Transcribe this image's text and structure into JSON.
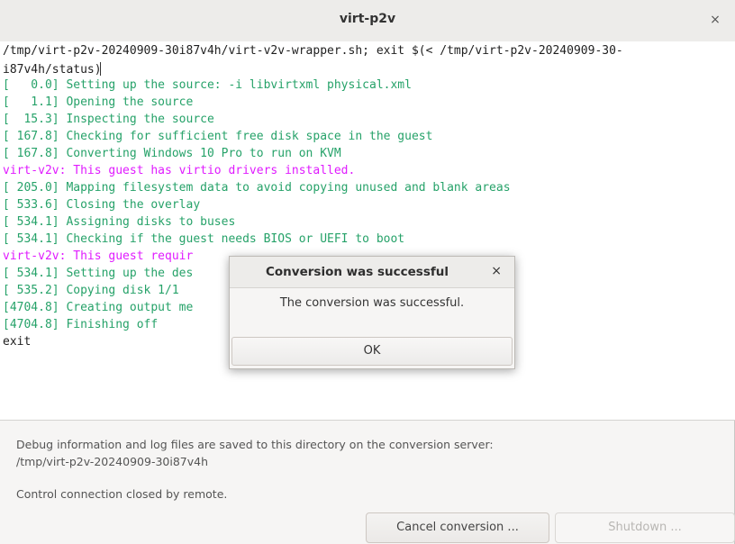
{
  "window": {
    "title": "virt-p2v",
    "close_glyph": "×"
  },
  "terminal": {
    "lines": [
      {
        "text": "/tmp/virt-p2v-20240909-30i87v4h/virt-v2v-wrapper.sh; exit $(< /tmp/virt-p2v-20240909-30-",
        "color": "black"
      },
      {
        "text": "i87v4h/status)",
        "color": "black"
      },
      {
        "text": "[   0.0] Setting up the source: -i libvirtxml physical.xml",
        "color": "green"
      },
      {
        "text": "[   1.1] Opening the source",
        "color": "green"
      },
      {
        "text": "[  15.3] Inspecting the source",
        "color": "green"
      },
      {
        "text": "[ 167.8] Checking for sufficient free disk space in the guest",
        "color": "green"
      },
      {
        "text": "[ 167.8] Converting Windows 10 Pro to run on KVM",
        "color": "green"
      },
      {
        "text": "virt-v2v: This guest has virtio drivers installed.",
        "color": "magenta"
      },
      {
        "text": "[ 205.0] Mapping filesystem data to avoid copying unused and blank areas",
        "color": "green"
      },
      {
        "text": "[ 533.6] Closing the overlay",
        "color": "green"
      },
      {
        "text": "[ 534.1] Assigning disks to buses",
        "color": "green"
      },
      {
        "text": "[ 534.1] Checking if the guest needs BIOS or UEFI to boot",
        "color": "green"
      },
      {
        "text": "virt-v2v: This guest requir",
        "color": "magenta"
      },
      {
        "text": "[ 534.1] Setting up the des",
        "color": "green"
      },
      {
        "text": "[ 535.2] Copying disk 1/1",
        "color": "green"
      },
      {
        "text": "[4704.8] Creating output me",
        "color": "green"
      },
      {
        "text": "[4704.8] Finishing off",
        "color": "green"
      },
      {
        "text": "exit",
        "color": "black"
      }
    ]
  },
  "info": {
    "debug_line1": "Debug information and log files are saved to this directory on the conversion server:",
    "debug_line2": "/tmp/virt-p2v-20240909-30i87v4h",
    "connection_status": "Control connection closed by remote."
  },
  "buttons": {
    "cancel": "Cancel conversion ...",
    "shutdown": "Shutdown ..."
  },
  "dialog": {
    "title": "Conversion was successful",
    "close_glyph": "×",
    "message": "The conversion was successful.",
    "ok_label": "OK"
  },
  "colors": {
    "green": "#26a269",
    "magenta": "#e01bff",
    "black": "#1f1f1f"
  },
  "icons": {
    "window_close": "close-icon",
    "dialog_close": "close-icon",
    "text_cursor": "ibeam-cursor-icon"
  }
}
